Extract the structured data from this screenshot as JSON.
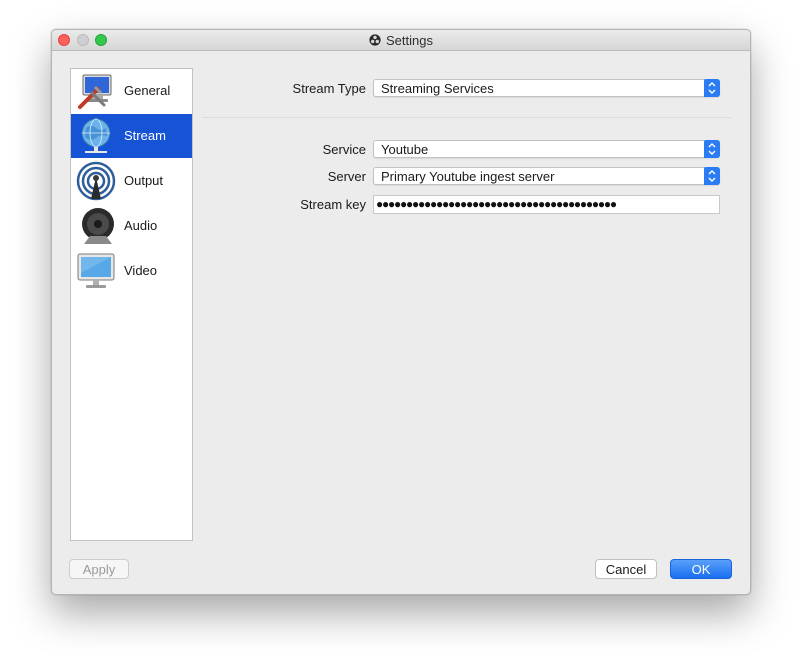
{
  "window": {
    "title": "Settings"
  },
  "sidebar": {
    "items": [
      {
        "label": "General",
        "icon": "general-icon",
        "selected": false
      },
      {
        "label": "Stream",
        "icon": "globe-network-icon",
        "selected": true
      },
      {
        "label": "Output",
        "icon": "broadcast-icon",
        "selected": false
      },
      {
        "label": "Audio",
        "icon": "speaker-icon",
        "selected": false
      },
      {
        "label": "Video",
        "icon": "monitor-icon",
        "selected": false
      }
    ]
  },
  "stream": {
    "stream_type_label": "Stream Type",
    "stream_type_value": "Streaming Services",
    "service_label": "Service",
    "service_value": "Youtube",
    "server_label": "Server",
    "server_value": "Primary Youtube ingest server",
    "stream_key_label": "Stream key",
    "stream_key_value": "●●●●●●●●●●●●●●●●●●●●●●●●●●●●●●●●●●●●●●●●"
  },
  "buttons": {
    "apply": "Apply",
    "cancel": "Cancel",
    "ok": "OK"
  },
  "colors": {
    "selection": "#1753d5",
    "accent": "#1a6ff1",
    "close": "#fc605c",
    "maximize": "#34c84a"
  }
}
